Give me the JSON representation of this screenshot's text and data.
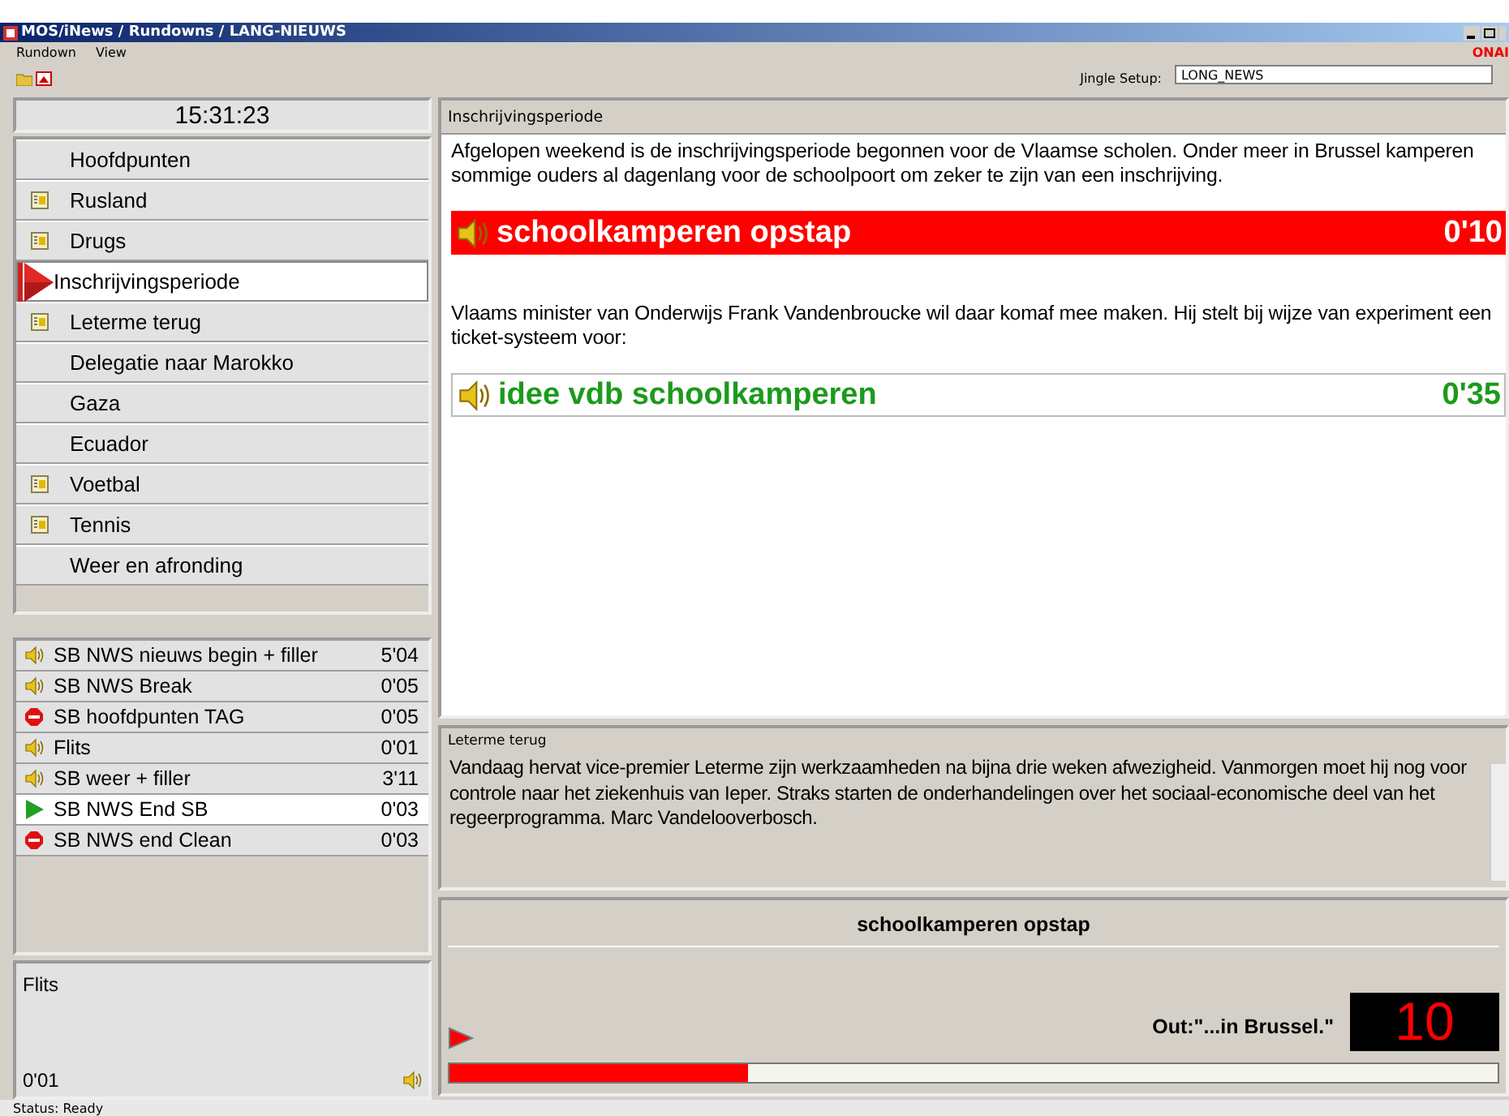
{
  "window": {
    "title": "MOS/iNews / Rundowns / LANG-NIEUWS"
  },
  "menu": [
    {
      "label": "Rundown"
    },
    {
      "label": "View"
    }
  ],
  "onair": "ONAI",
  "jingle": {
    "label": "Jingle Setup:",
    "value": "LONG_NEWS"
  },
  "clock": "15:31:23",
  "stories": [
    {
      "label": "Hoofdpunten",
      "kind": "plain",
      "selected": false
    },
    {
      "label": "Rusland",
      "kind": "media",
      "selected": false
    },
    {
      "label": "Drugs",
      "kind": "media",
      "selected": false
    },
    {
      "label": "Inschrijvingsperiode",
      "kind": "plain",
      "selected": true
    },
    {
      "label": "Leterme terug",
      "kind": "media",
      "selected": false
    },
    {
      "label": "Delegatie naar Marokko",
      "kind": "plain",
      "selected": false
    },
    {
      "label": "Gaza",
      "kind": "plain",
      "selected": false
    },
    {
      "label": "Ecuador",
      "kind": "plain",
      "selected": false
    },
    {
      "label": "Voetbal",
      "kind": "media",
      "selected": false
    },
    {
      "label": "Tennis",
      "kind": "media",
      "selected": false
    },
    {
      "label": "Weer en afronding",
      "kind": "plain",
      "selected": false
    }
  ],
  "elements": [
    {
      "label": "SB NWS nieuws begin + filler",
      "duration": "5'04",
      "kind": "audio",
      "selected": false
    },
    {
      "label": "SB NWS Break",
      "duration": "0'05",
      "kind": "audio",
      "selected": false
    },
    {
      "label": "SB hoofdpunten TAG",
      "duration": "0'05",
      "kind": "stop",
      "selected": false
    },
    {
      "label": "Flits",
      "duration": "0'01",
      "kind": "audio",
      "selected": false
    },
    {
      "label": "SB weer + filler",
      "duration": "3'11",
      "kind": "audio",
      "selected": false
    },
    {
      "label": "SB NWS End SB",
      "duration": "0'03",
      "kind": "play",
      "selected": true
    },
    {
      "label": "SB NWS end Clean",
      "duration": "0'03",
      "kind": "stop",
      "selected": false
    }
  ],
  "element_detail": {
    "title": "Flits",
    "duration": "0'01"
  },
  "script": {
    "title": "Inschrijvingsperiode",
    "blocks": [
      {
        "kind": "text",
        "text": "Afgelopen weekend is de inschrijvingsperiode begonnen voor de Vlaamse scholen. Onder meer in Brussel kamperen sommige ouders al dagenlang voor de schoolpoort om zeker te zijn van een inschrijving."
      },
      {
        "kind": "cue",
        "label": "schoolkamperen opstap",
        "duration": "0'10",
        "playing": true
      },
      {
        "kind": "text",
        "text": "Vlaams minister van Onderwijs Frank Vandenbroucke wil daar komaf mee maken. Hij stelt bij wijze van experiment een ticket-systeem voor:"
      },
      {
        "kind": "cue",
        "label": "idee vdb schoolkamperen",
        "duration": "0'35",
        "playing": false
      }
    ]
  },
  "preview": {
    "title": "Leterme terug",
    "text": "Vandaag hervat vice-premier Leterme zijn werkzaamheden na bijna drie weken afwezigheid.  Vanmorgen moet hij nog voor controle naar het ziekenhuis van Ieper.  Straks starten de onderhandelingen over het sociaal-economische deel van het regeerprogramma.  Marc Vandelooverbosch."
  },
  "player": {
    "title": "schoolkamperen opstap",
    "out": "Out:\"...in Brussel.\"",
    "countdown": "10",
    "level": 0.285
  },
  "status_bar": "Status: Ready"
}
